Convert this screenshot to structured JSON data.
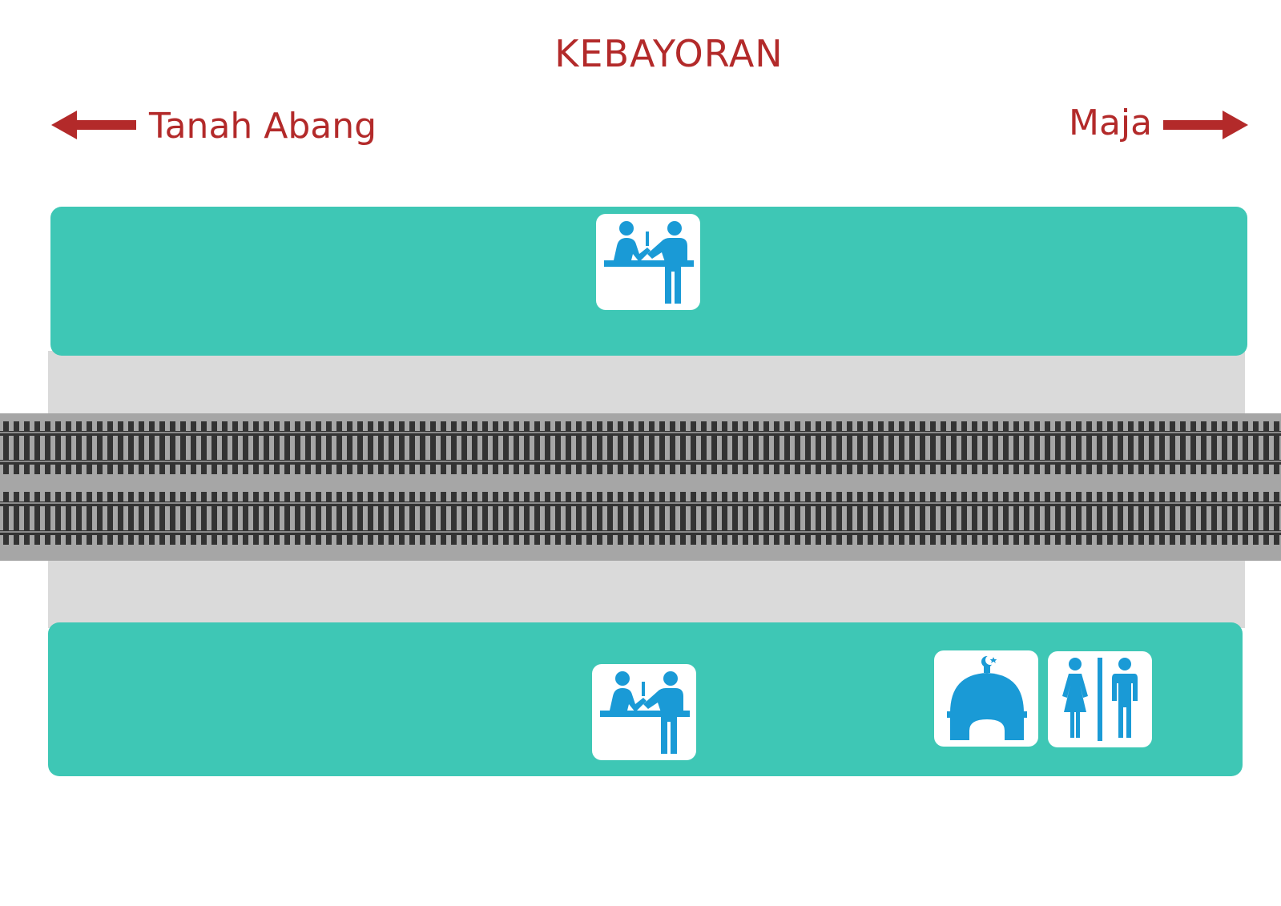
{
  "station": {
    "name": "KEBAYORAN"
  },
  "directions": {
    "left": {
      "label": "Tanah Abang",
      "icon": "arrow-left-icon"
    },
    "right": {
      "label": "Maja",
      "icon": "arrow-right-icon"
    }
  },
  "platforms": {
    "north": {
      "icons": [
        "ticket-counter-icon"
      ]
    },
    "south": {
      "icons": [
        "ticket-counter-icon",
        "mosque-icon",
        "restroom-icon"
      ]
    }
  },
  "tracks": {
    "count": 2
  },
  "colors": {
    "accent": "#b32a2a",
    "platform": "#3ec7b5",
    "walkway": "#dadada",
    "track_bed": "#a6a6a6",
    "rail": "#333333",
    "icon": "#1a9ad6"
  }
}
